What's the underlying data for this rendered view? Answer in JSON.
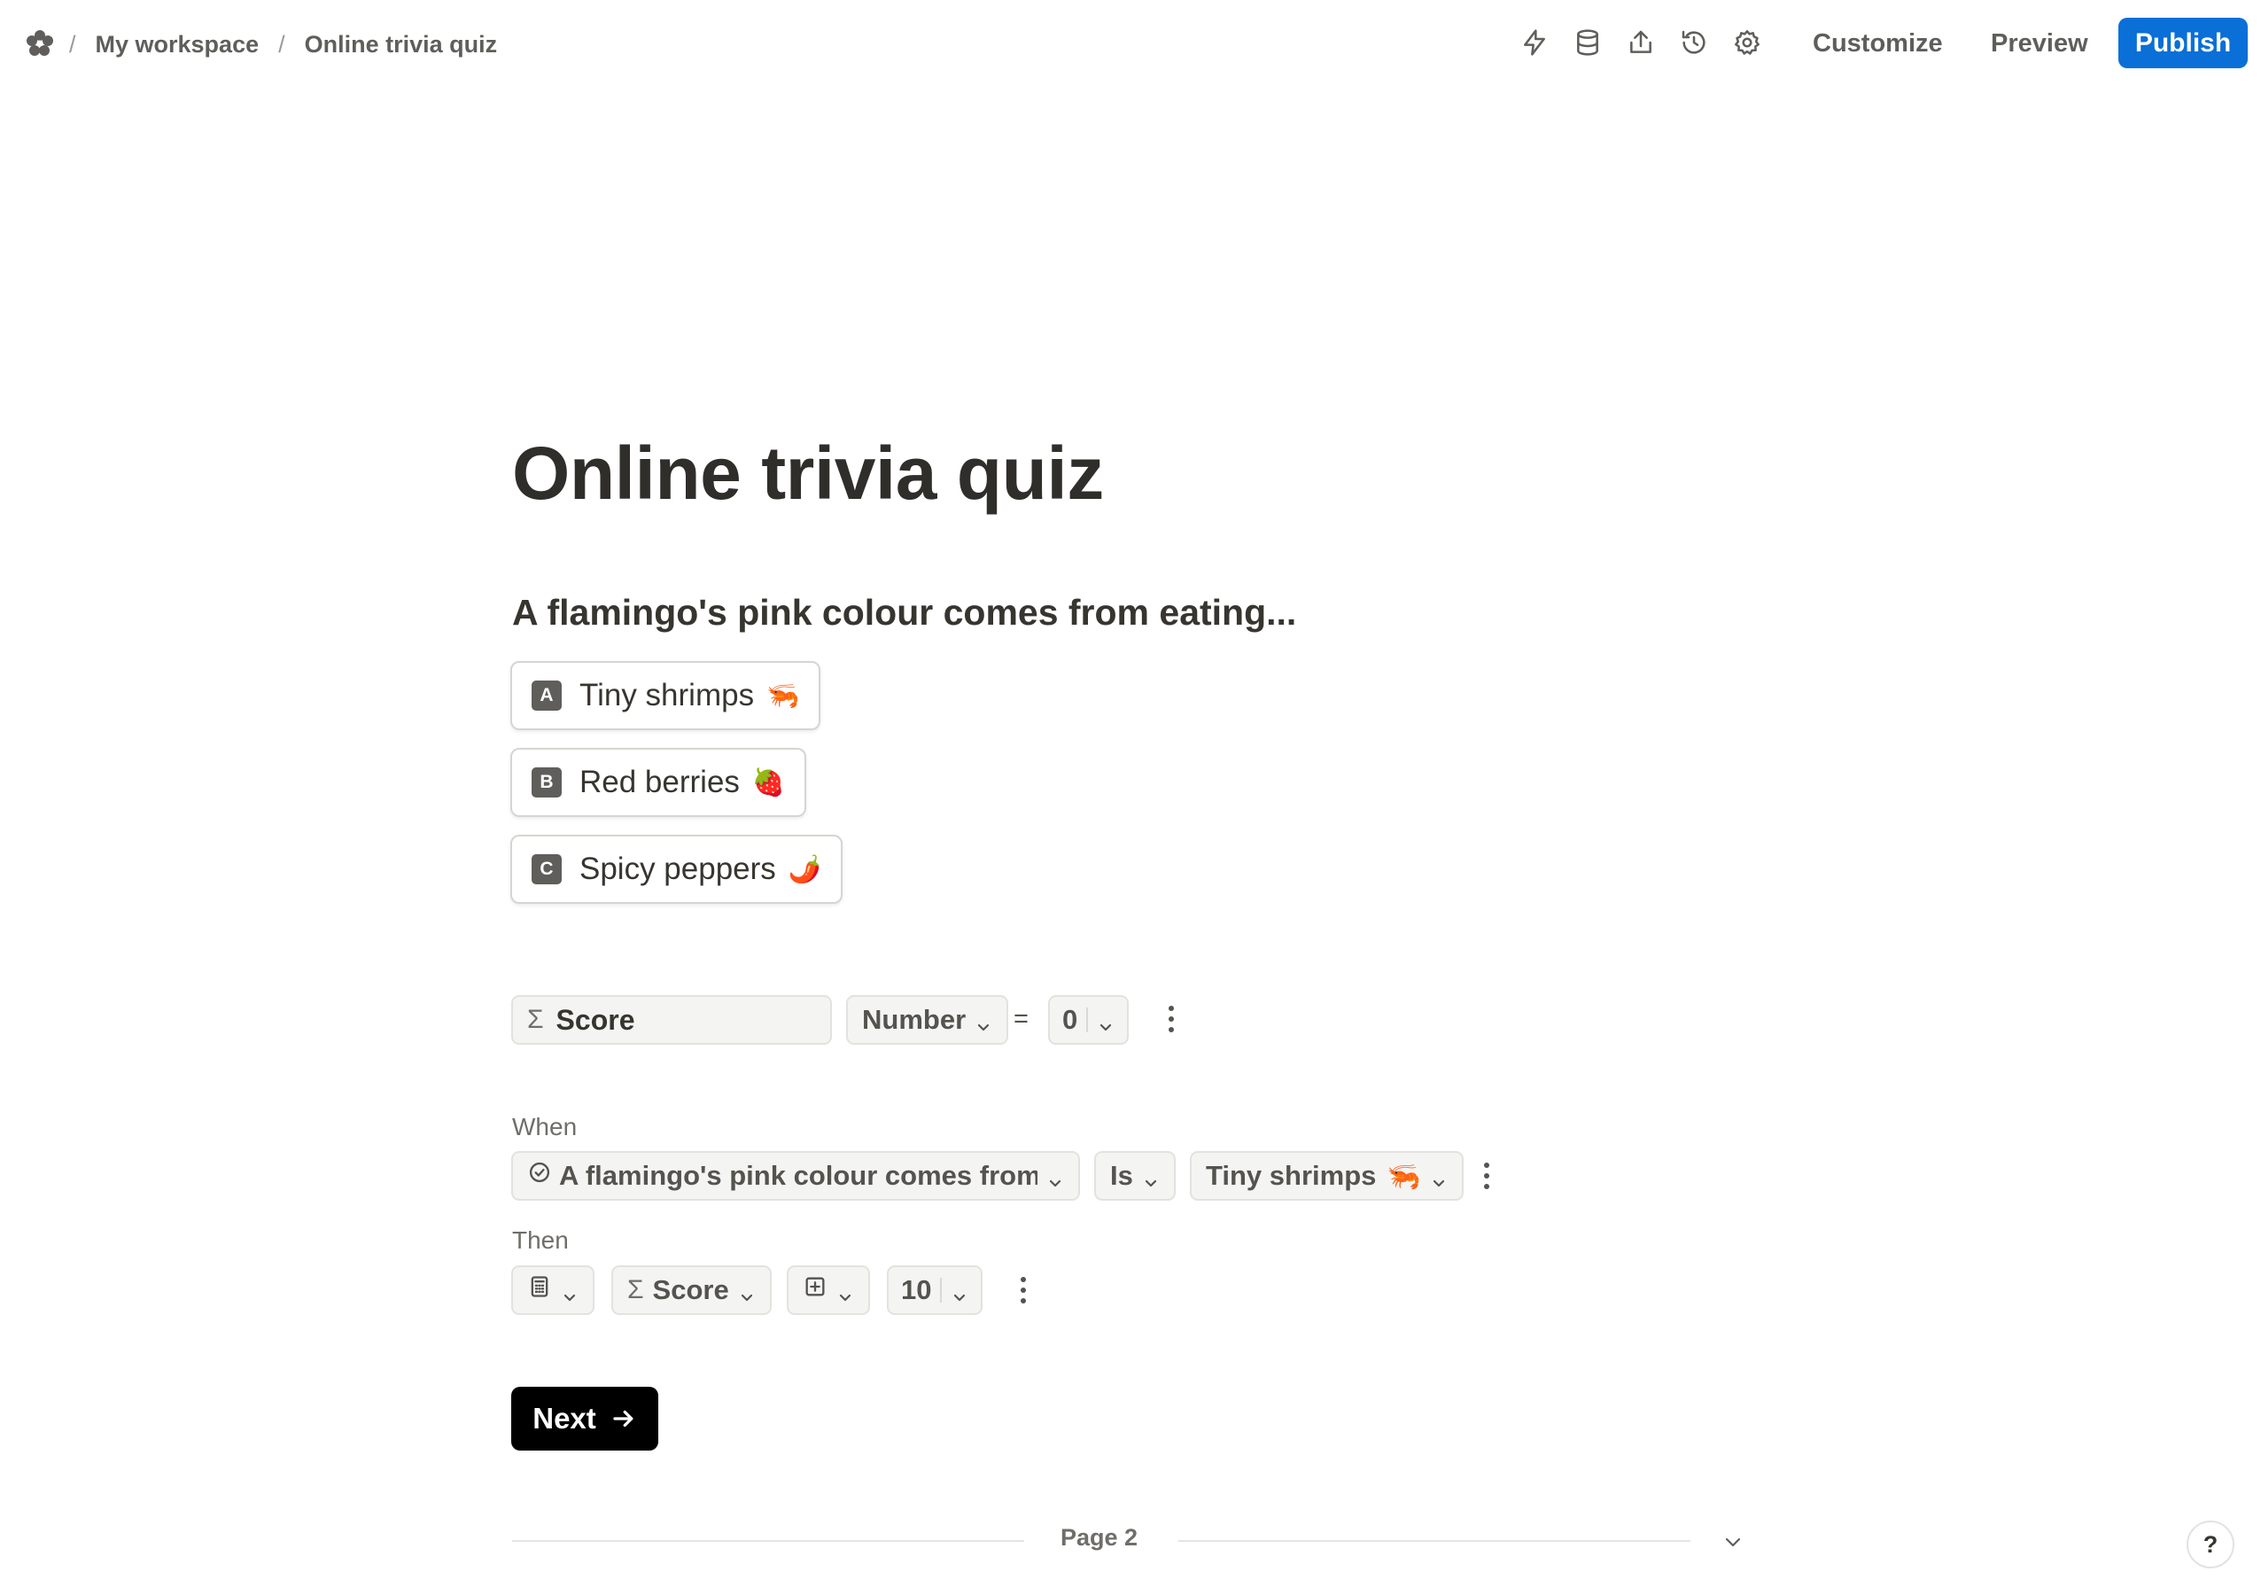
{
  "breadcrumb": {
    "workspace": "My workspace",
    "form": "Online trivia quiz",
    "separator": "/"
  },
  "toolbar": {
    "icons": [
      "lightning-icon",
      "database-icon",
      "share-icon",
      "history-icon",
      "settings-icon"
    ],
    "customize_label": "Customize",
    "preview_label": "Preview",
    "publish_label": "Publish",
    "publish_color": "#0a6fd6"
  },
  "form": {
    "title": "Online trivia quiz",
    "question": "A flamingo's pink colour comes from eating...",
    "options": [
      {
        "key": "A",
        "label": "Tiny shrimps",
        "emoji": "🦐"
      },
      {
        "key": "B",
        "label": "Red berries",
        "emoji": "🍓"
      },
      {
        "key": "C",
        "label": "Spicy peppers",
        "emoji": "🌶️"
      }
    ]
  },
  "calculation": {
    "field_name": "Score",
    "type": "Number",
    "equals": "=",
    "initial_value": "0"
  },
  "logic": {
    "when_label": "When",
    "condition_field": "A flamingo's pink colour comes from ...",
    "operator": "Is",
    "condition_value": "Tiny shrimps",
    "condition_emoji": "🦐",
    "then_label": "Then",
    "action_target": "Score",
    "action_value": "10"
  },
  "navigation": {
    "next_label": "Next",
    "page_label": "Page 2",
    "help_label": "?"
  }
}
